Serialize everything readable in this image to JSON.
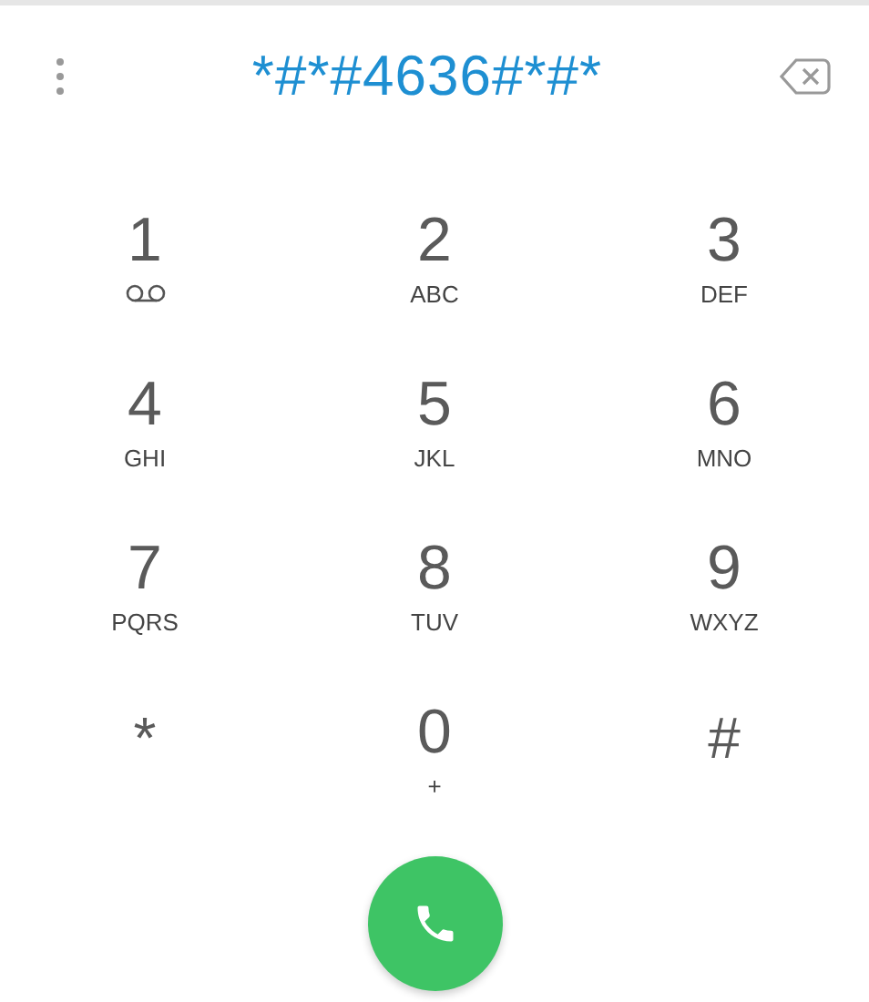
{
  "dialed_number": "*#*#4636#*#*",
  "keys": [
    {
      "digit": "1",
      "kind": "voicemail"
    },
    {
      "digit": "2",
      "kind": "letters",
      "letters": "ABC"
    },
    {
      "digit": "3",
      "kind": "letters",
      "letters": "DEF"
    },
    {
      "digit": "4",
      "kind": "letters",
      "letters": "GHI"
    },
    {
      "digit": "5",
      "kind": "letters",
      "letters": "JKL"
    },
    {
      "digit": "6",
      "kind": "letters",
      "letters": "MNO"
    },
    {
      "digit": "7",
      "kind": "letters",
      "letters": "PQRS"
    },
    {
      "digit": "8",
      "kind": "letters",
      "letters": "TUV"
    },
    {
      "digit": "9",
      "kind": "letters",
      "letters": "WXYZ"
    },
    {
      "digit": "*",
      "kind": "symbol"
    },
    {
      "digit": "0",
      "kind": "letters",
      "letters": "+"
    },
    {
      "digit": "#",
      "kind": "symbol"
    }
  ]
}
